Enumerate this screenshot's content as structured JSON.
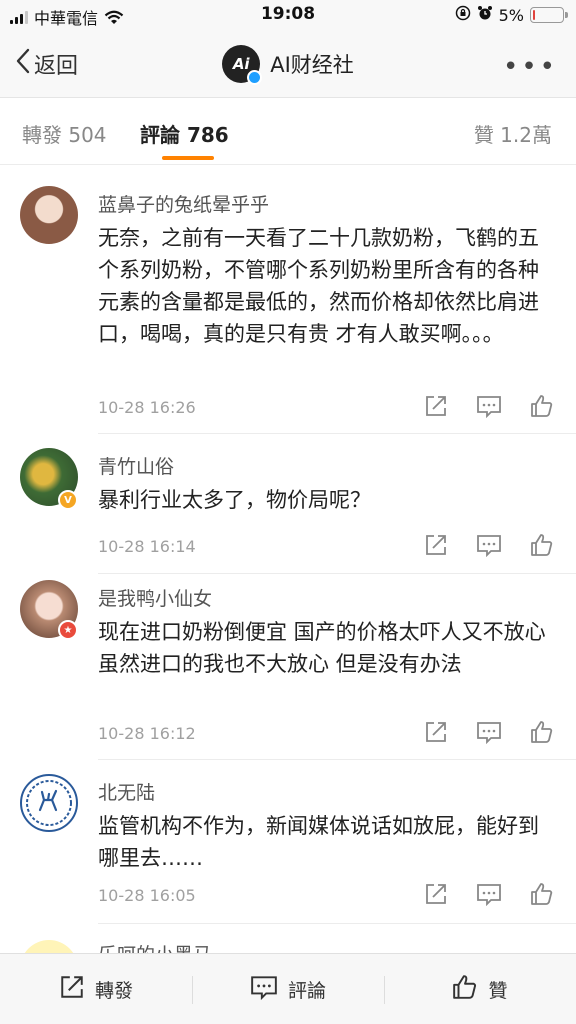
{
  "status_bar": {
    "carrier": "中華電信",
    "time": "19:08",
    "battery_percent": "5%",
    "battery_level": 0.05
  },
  "header": {
    "back_label": "返回",
    "account_name": "AI财经社",
    "account_logo_text": "Ai"
  },
  "tabs": [
    {
      "label": "轉發 504"
    },
    {
      "label": "評論 786"
    },
    {
      "label": "贊 1.2萬"
    }
  ],
  "comments": [
    {
      "name": "蓝鼻子的兔纸晕乎乎",
      "text": "无奈，之前有一天看了二十几款奶粉，飞鹤的五个系列奶粉，不管哪个系列奶粉里所含有的各种元素的含量都是最低的，然而价格却依然比肩进口，喝喝，真的是只有贵 才有人敢买啊。。。",
      "time": "10-28 16:26"
    },
    {
      "name": "青竹山俗",
      "text": "暴利行业太多了，物价局呢？",
      "time": "10-28 16:14"
    },
    {
      "name": "是我鸭小仙女",
      "text": "现在进口奶粉倒便宜 国产的价格太吓人又不放心 虽然进口的我也不大放心 但是没有办法",
      "time": "10-28 16:12"
    },
    {
      "name": "北无陆",
      "text": "监管机构不作为，新闻媒体说话如放屁，能好到哪里去……",
      "time": "10-28 16:05"
    }
  ],
  "peek_comment": {
    "name": "乐呵的小黑马"
  },
  "toolbar": {
    "repost_label": "轉發",
    "comment_label": "評論",
    "like_label": "贊"
  },
  "colors": {
    "accent": "#ff8200",
    "verified_blue": "#1e9fff",
    "battery_low": "#e0433d"
  }
}
